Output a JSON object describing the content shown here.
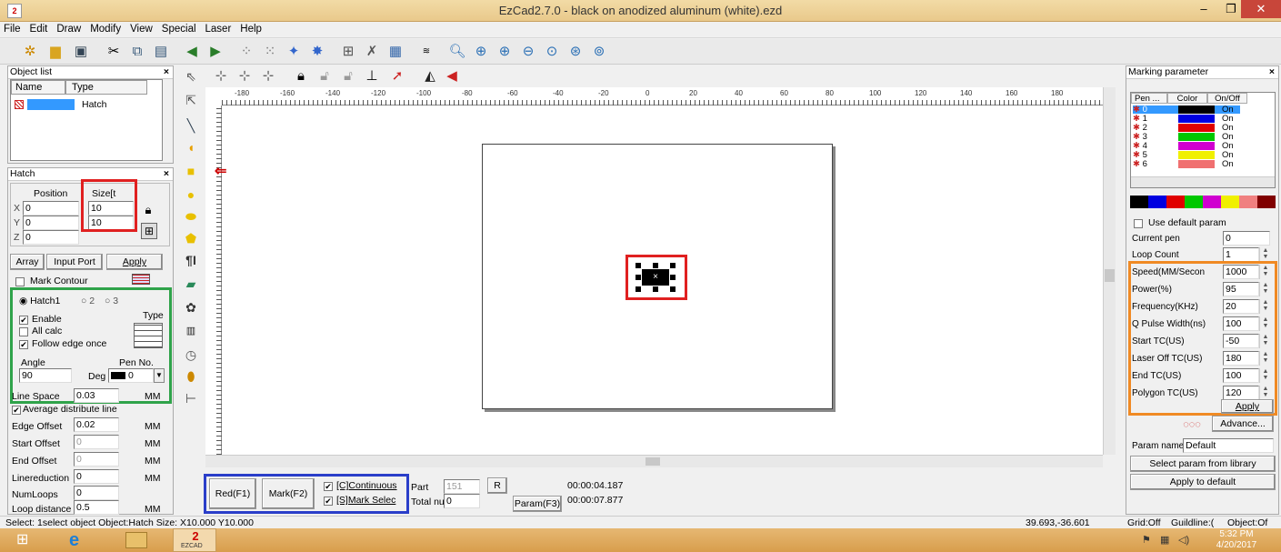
{
  "window": {
    "title": "EzCad2.7.0 - black on anodized aluminum (white).ezd",
    "app_icon_text": "2"
  },
  "menu": [
    "File",
    "Edit",
    "Draw",
    "Modify",
    "View",
    "Special",
    "Laser",
    "Help"
  ],
  "object_list": {
    "title": "Object list",
    "col_name": "Name",
    "col_type": "Type",
    "item_type": "Hatch"
  },
  "hatch_panel": {
    "title": "Hatch",
    "position_label": "Position",
    "size_label": "Size[t",
    "x_label": "X",
    "y_label": "Y",
    "z_label": "Z",
    "x_pos": "0",
    "y_pos": "0",
    "z_pos": "0",
    "x_size": "10",
    "y_size": "10",
    "array_btn": "Array",
    "input_port_btn": "Input Port",
    "apply_btn": "Apply",
    "mark_contour": "Mark Contour",
    "hatch1": "Hatch1",
    "hatch2": "2",
    "hatch3": "3",
    "enable": "Enable",
    "type_label": "Type",
    "all_calc": "All calc",
    "follow_edge": "Follow edge once",
    "angle_label": "Angle",
    "pen_no_label": "Pen No.",
    "angle_value": "90",
    "deg_label": "Deg",
    "pen_value": "0",
    "line_space_label": "Line Space",
    "line_space_value": "0.03",
    "mm": "MM",
    "avg_distribute": "Average distribute line",
    "edge_offset_label": "Edge Offset",
    "edge_offset_value": "0.02",
    "start_offset_label": "Start Offset",
    "start_offset_value": "0",
    "end_offset_label": "End Offset",
    "end_offset_value": "0",
    "linereduction_label": "Linereduction",
    "linereduction_value": "0",
    "numloops_label": "NumLoops",
    "numloops_value": "0",
    "loop_distance_label": "Loop distance",
    "loop_distance_value": "0.5"
  },
  "ruler": {
    "h_ticks": [
      "-180",
      "-160",
      "-140",
      "-120",
      "-100",
      "-80",
      "-60",
      "-40",
      "-20",
      "0",
      "20",
      "40",
      "60",
      "80",
      "100",
      "120",
      "140",
      "160",
      "180"
    ]
  },
  "bottom_bar": {
    "red_btn": "Red(F1)",
    "mark_btn": "Mark(F2)",
    "continuous": "[C]Continuous",
    "mark_selected": "[S]Mark Selec",
    "part_label": "Part",
    "part_value": "151",
    "r_btn": "R",
    "total_label": "Total nu",
    "total_value": "0",
    "param_btn": "Param(F3)",
    "time1": "00:00:04.187",
    "time2": "00:00:07.877"
  },
  "marking_param": {
    "title": "Marking parameter",
    "col_pen": "Pen ...",
    "col_color": "Color",
    "col_onoff": "On/Off",
    "pens": [
      {
        "id": "0",
        "color": "#000000",
        "state": "On"
      },
      {
        "id": "1",
        "color": "#0000e0",
        "state": "On"
      },
      {
        "id": "2",
        "color": "#e00000",
        "state": "On"
      },
      {
        "id": "3",
        "color": "#00c800",
        "state": "On"
      },
      {
        "id": "4",
        "color": "#d000d0",
        "state": "On"
      },
      {
        "id": "5",
        "color": "#f0f000",
        "state": "On"
      },
      {
        "id": "6",
        "color": "#f07070",
        "state": "On"
      }
    ],
    "palette": [
      "#000000",
      "#0000e0",
      "#e00000",
      "#00c800",
      "#d000d0",
      "#f0f000",
      "#f08080",
      "#800000"
    ],
    "use_default": "Use default param",
    "current_pen_label": "Current pen",
    "current_pen_value": "0",
    "loop_count_label": "Loop Count",
    "loop_count_value": "1",
    "params": [
      {
        "label": "Speed(MM/Secon",
        "value": "1000"
      },
      {
        "label": "Power(%)",
        "value": "95"
      },
      {
        "label": "Frequency(KHz)",
        "value": "20"
      },
      {
        "label": "Q Pulse Width(ns)",
        "value": "100"
      },
      {
        "label": "Start TC(US)",
        "value": "-50"
      },
      {
        "label": "Laser Off TC(US)",
        "value": "180"
      },
      {
        "label": "End TC(US)",
        "value": "100"
      },
      {
        "label": "Polygon TC(US)",
        "value": "120"
      }
    ],
    "apply_btn": "Apply",
    "advance_btn": "Advance...",
    "param_name_label": "Param name",
    "param_name_value": "Default",
    "select_library_btn": "Select param from library",
    "apply_default_btn": "Apply to default"
  },
  "status": {
    "text": "Select: 1select object Object:Hatch Size: X10.000 Y10.000",
    "coords": "39.693,-36.601",
    "grid": "Grid:Off",
    "guideline": "Guildline:(",
    "object": "Object:Of"
  },
  "taskbar": {
    "time": "5:32 PM",
    "date": "4/20/2017",
    "ezcad_label": "EZCAD"
  }
}
